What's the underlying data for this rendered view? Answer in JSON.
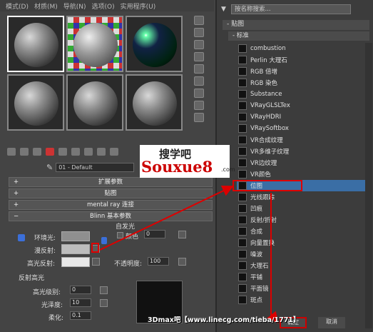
{
  "menu": [
    "模式(D)",
    "材质(M)",
    "导航(N)",
    "选项(O)",
    "实用程序(U)"
  ],
  "material_name": "01 - Default",
  "rollouts": [
    "扩展参数",
    "贴图",
    "mental ray 连接",
    "Blinn 基本参数"
  ],
  "blinn": {
    "ambient_label": "环境光:",
    "diffuse_label": "漫反射:",
    "specular_label": "高光反射:",
    "selfillum_group": "自发光",
    "color_label": "颜色",
    "selfillum_value": "0",
    "opacity_label": "不透明度:",
    "opacity_value": "100",
    "spec_group": "反射高光",
    "spec_level_label": "高光级别:",
    "spec_level_value": "0",
    "gloss_label": "光泽度:",
    "gloss_value": "10",
    "soften_label": "柔化:",
    "soften_value": "0.1"
  },
  "browser": {
    "search_placeholder": "按名称搜索...",
    "category": "- 贴图",
    "subcategory": "- 标准",
    "items": [
      "combustion",
      "Perlin 大理石",
      "RGB 倍增",
      "RGB 染色",
      "Substance",
      "VRayGLSLTex",
      "VRayHDRI",
      "VRaySoftbox",
      "VR合成纹理",
      "VR多维子纹理",
      "VR边纹理",
      "VR颜色",
      "位图",
      "光线跟踪",
      "凹痕",
      "反射/折射",
      "合成",
      "向量置换",
      "噪波",
      "大理石",
      "平铺",
      "平面镜",
      "斑点"
    ],
    "selected_index": 12,
    "ok_label": "确定",
    "cancel_label": "取消"
  },
  "watermark": {
    "cn": "搜学吧",
    "en": "Souxue8",
    "domain": ".com",
    "bottom": "3Dmax吧【www.linecg.com/tieba/1771】"
  }
}
